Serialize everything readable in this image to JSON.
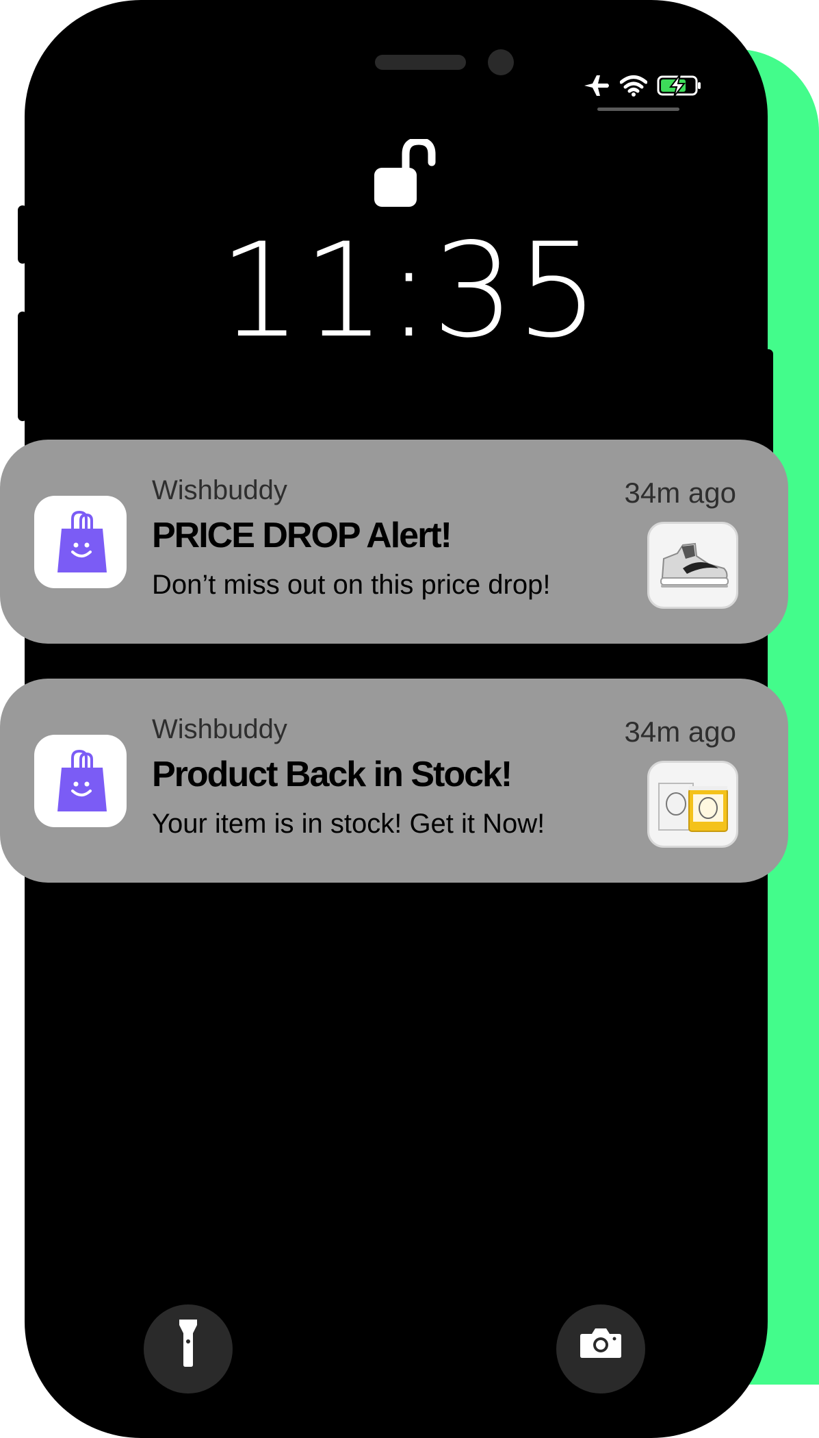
{
  "colors": {
    "accent_green": "#43fc8b",
    "phone_body": "#000000",
    "notification_bg": "#9a9a9a",
    "app_icon_bag": "#7b5cf5",
    "battery_green": "#3ddc5a"
  },
  "status_bar": {
    "icons": [
      "airplane-icon",
      "wifi-icon",
      "battery-charging-icon"
    ]
  },
  "lock_screen": {
    "lock_icon": "unlocked-padlock-icon",
    "time": "11:35"
  },
  "notifications": [
    {
      "app_icon": "shopping-bag-icon",
      "app_name": "Wishbuddy",
      "time_ago": "34m ago",
      "title": "PRICE DROP Alert!",
      "body": "Don’t miss out on this price drop!",
      "thumbnail": "sneaker-thumbnail"
    },
    {
      "app_icon": "shopping-bag-icon",
      "app_name": "Wishbuddy",
      "time_ago": "34m ago",
      "title": "Product Back in Stock!",
      "body": "Your item is in stock! Get it Now!",
      "thumbnail": "candle-thumbnail"
    }
  ],
  "bottom_controls": {
    "left": "flashlight-icon",
    "right": "camera-icon"
  }
}
